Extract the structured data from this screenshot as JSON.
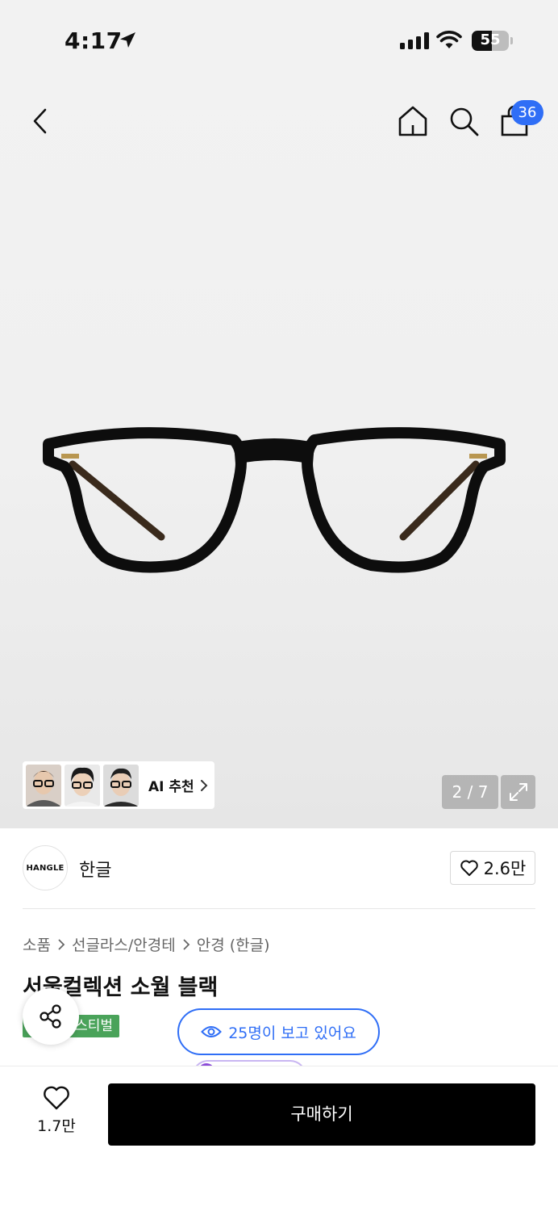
{
  "status_bar": {
    "time": "4:17",
    "battery": "55",
    "battery_level_percent": 55
  },
  "nav": {
    "cart_count": "36"
  },
  "gallery": {
    "ai_label": "AI 추천",
    "page_indicator": "2 / 7"
  },
  "brand": {
    "logo_text": "HANGLE",
    "name": "한글",
    "like_count": "2.6만"
  },
  "breadcrumb": [
    "소품",
    "선글라스/안경테",
    "안경 (한글)"
  ],
  "product": {
    "title": "서울컬렉션 소월 블랙",
    "tag": "스티벌"
  },
  "viewers": {
    "text": "25명이 보고 있어요"
  },
  "bottom": {
    "wish_count": "1.7만",
    "buy_label": "구매하기"
  },
  "colors": {
    "accent_blue": "#2f6ef6",
    "tag_green": "#4aa35a",
    "buy_button": "#000000"
  },
  "icons": [
    "location-arrow-icon",
    "signal-icon",
    "wifi-icon",
    "battery-icon",
    "back-icon",
    "home-icon",
    "search-icon",
    "shopping-bag-icon",
    "chevron-right-icon",
    "expand-icon",
    "heart-icon",
    "share-icon",
    "eye-icon"
  ]
}
